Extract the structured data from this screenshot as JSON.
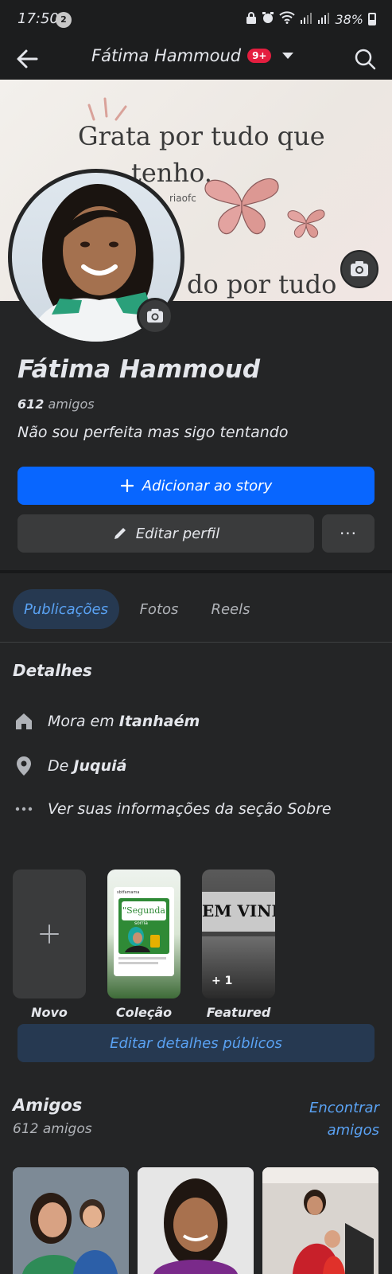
{
  "status_bar": {
    "time": "17:50",
    "notif_count": "2",
    "battery": "38%"
  },
  "nav": {
    "title": "Fátima Hammoud",
    "badge": "9+"
  },
  "cover": {
    "line1": "Grata  por tudo que",
    "line2": "tenho.",
    "handle": "riaofc",
    "line3": "do por tudo"
  },
  "profile": {
    "name": "Fátima Hammoud",
    "friends_count": "612",
    "friends_word": "amigos",
    "bio": "Não sou perfeita mas sigo tentando"
  },
  "actions": {
    "add_story": "Adicionar ao story",
    "edit_profile": "Editar perfil",
    "more": "···"
  },
  "tabs": [
    {
      "label": "Publicações",
      "active": true
    },
    {
      "label": "Fotos",
      "active": false
    },
    {
      "label": "Reels",
      "active": false
    }
  ],
  "details": {
    "title": "Detalhes",
    "lives_prefix": "Mora em",
    "lives_place": "Itanhaém",
    "from_prefix": "De",
    "from_place": "Juquiá",
    "about": "Ver suas informações da seção Sobre"
  },
  "featured": {
    "items": [
      {
        "label": "Novo"
      },
      {
        "label": "Coleção",
        "preview_header": "sbtfamama",
        "preview_text1": "\"Segunda",
        "preview_text2": "sorria"
      },
      {
        "label": "Featured",
        "preview_text": "EM VIND",
        "count": "+ 1"
      }
    ],
    "edit_button": "Editar detalhes públicos"
  },
  "friends": {
    "title": "Amigos",
    "subtitle": "612 amigos",
    "find_link": "Encontrar amigos"
  },
  "colors": {
    "background": "#242526",
    "primary": "#0866ff",
    "link": "#5aa2f3",
    "badge": "#e41e3f"
  }
}
